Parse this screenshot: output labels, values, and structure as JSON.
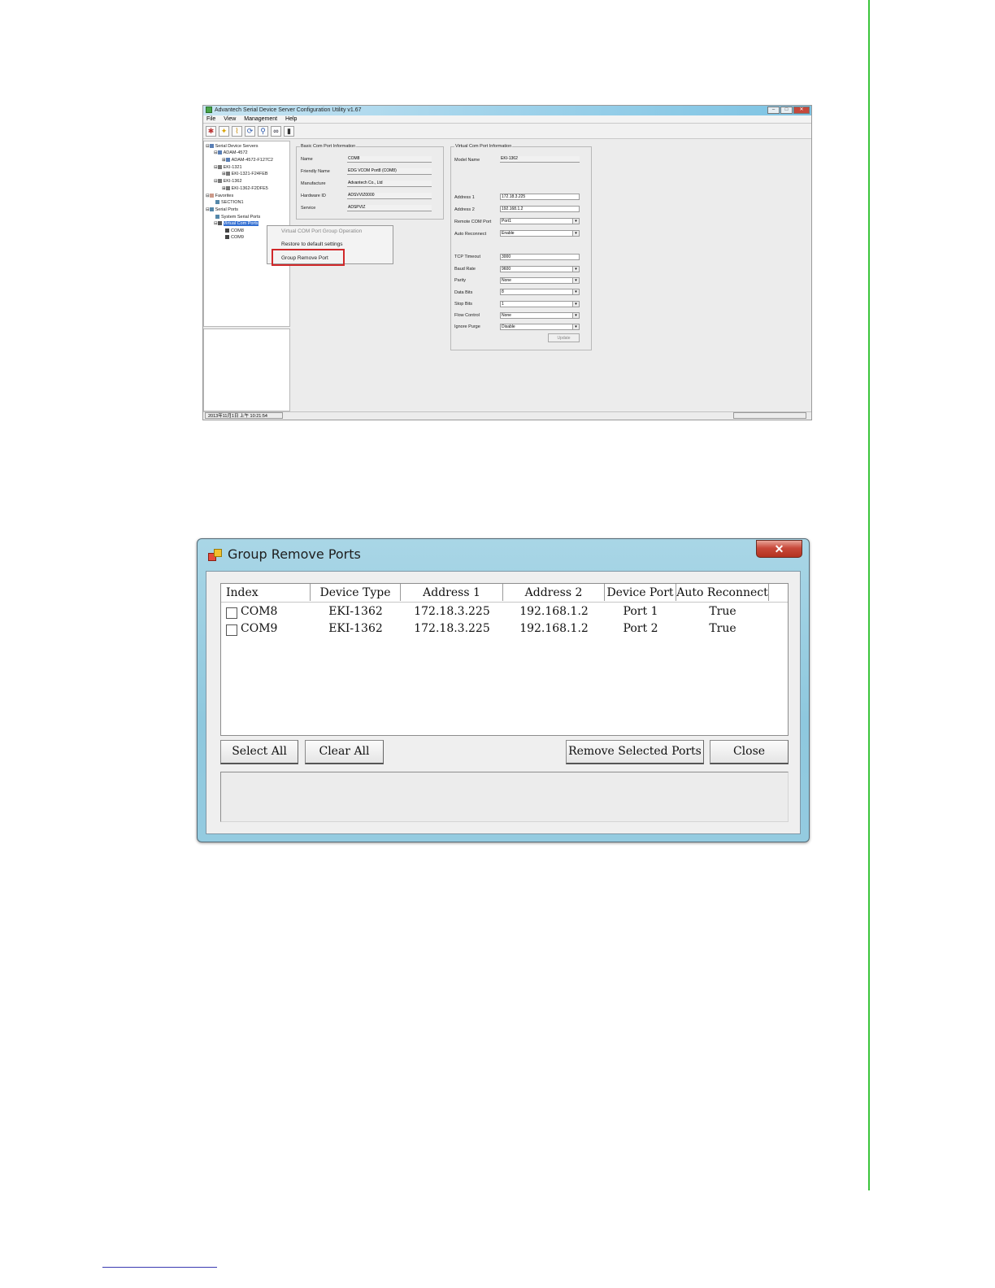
{
  "config_utility": {
    "title": "Advantech Serial Device Server Configuration Utility v1.67",
    "menu": [
      "File",
      "View",
      "Management",
      "Help"
    ],
    "toolbar_icons": [
      "add-icon",
      "search-icon",
      "broom-icon",
      "refresh-icon",
      "magnifier-icon",
      "binoculars-icon",
      "serial-port-icon"
    ],
    "tree": [
      "Serial Device Servers",
      "ADAM-4572",
      "ADAM-4572-F127C2",
      "EKI-1321",
      "EKI-1321-F24FEB",
      "EKI-1362",
      "EKI-1362-F2DFE5",
      "Favorites",
      "SECTION1",
      "Serial Ports",
      "System Serial Ports",
      "Virtual Com Ports",
      "COM8",
      "COM9"
    ],
    "basic_info": {
      "label": "Basic Com Port Information",
      "fields": [
        {
          "label": "Name",
          "value": "COM8"
        },
        {
          "label": "Friendly Name",
          "value": "EDG VCOM Port8 (COM8)"
        },
        {
          "label": "Manufacture",
          "value": "Advantech Co., Ltd"
        },
        {
          "label": "Hardware ID",
          "value": "ADSVVIZ0000"
        },
        {
          "label": "Service",
          "value": "ADSPVIZ"
        }
      ]
    },
    "virtual_info": {
      "label": "Virtual Com Port Information",
      "model_name_label": "Model Name",
      "model_name": "EKI-1362",
      "fields_a": [
        {
          "label": "Address 1",
          "value": "172.18.3.225",
          "dropdown": false
        },
        {
          "label": "Address 2",
          "value": "192.168.1.2",
          "dropdown": false
        },
        {
          "label": "Remote COM Port",
          "value": "Port1",
          "dropdown": true
        },
        {
          "label": "Auto Reconnect",
          "value": "Enable",
          "dropdown": true
        }
      ],
      "fields_b": [
        {
          "label": "TCP Timeout",
          "value": "3000",
          "dropdown": false
        },
        {
          "label": "Baud Rate",
          "value": "9600",
          "dropdown": true
        },
        {
          "label": "Parity",
          "value": "None",
          "dropdown": true
        },
        {
          "label": "Data Bits",
          "value": "8",
          "dropdown": true
        },
        {
          "label": "Stop Bits",
          "value": "1",
          "dropdown": true
        },
        {
          "label": "Flow Control",
          "value": "None",
          "dropdown": true
        },
        {
          "label": "Ignore Purge",
          "value": "Disable",
          "dropdown": true
        }
      ],
      "update_label": "Update"
    },
    "context_menu": {
      "header": "Virtual COM Port Group Operation",
      "items": [
        "Restore to default settings",
        "Group Remove Port"
      ]
    },
    "status_time": "2013年11月1日 上午 10:21:54"
  },
  "group_remove_dialog": {
    "title": "Group Remove Ports",
    "close_glyph": "✕",
    "columns": [
      "Index",
      "Device Type",
      "Address 1",
      "Address 2",
      "Device Port",
      "Auto Reconnect"
    ],
    "rows": [
      {
        "index": "COM8",
        "device_type": "EKI-1362",
        "address1": "172.18.3.225",
        "address2": "192.168.1.2",
        "device_port": "Port 1",
        "auto_reconnect": "True",
        "checked": false
      },
      {
        "index": "COM9",
        "device_type": "EKI-1362",
        "address1": "172.18.3.225",
        "address2": "192.168.1.2",
        "device_port": "Port 2",
        "auto_reconnect": "True",
        "checked": false
      }
    ],
    "buttons": {
      "select_all": "Select All",
      "clear_all": "Clear All",
      "remove_selected": "Remove Selected Ports",
      "close": "Close"
    }
  }
}
